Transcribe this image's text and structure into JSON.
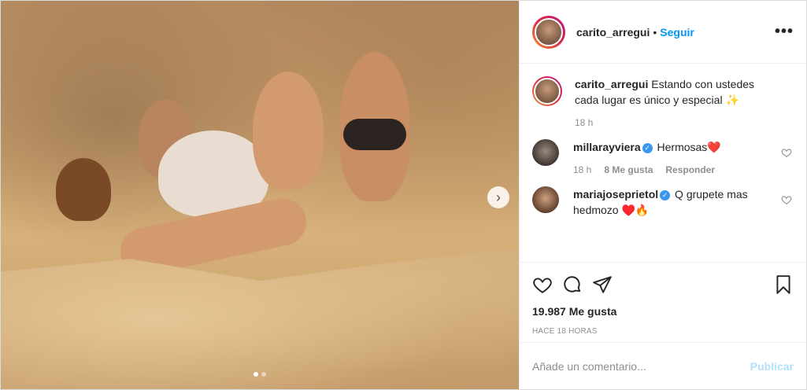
{
  "header": {
    "username": "carito_arregui",
    "separator": "•",
    "follow_label": "Seguir",
    "more_label": "•••"
  },
  "media": {
    "next_glyph": "›",
    "current_slide": 1,
    "total_slides": 2
  },
  "caption": {
    "username": "carito_arregui",
    "text": "Estando con ustedes cada lugar es único y especial ✨",
    "time": "18 h"
  },
  "comments": [
    {
      "username": "millarayviera",
      "verified": true,
      "text": "Hermosas❤️",
      "time": "18 h",
      "likes": "8 Me gusta",
      "reply_label": "Responder"
    },
    {
      "username": "mariajoseprietol",
      "verified": true,
      "text": "Q grupete mas hedmozo ♥️🔥"
    }
  ],
  "actions": {
    "icons": [
      "heart-icon",
      "comment-icon",
      "share-icon",
      "bookmark-icon"
    ],
    "likes": "19.987 Me gusta",
    "timestamp": "HACE 18 HORAS"
  },
  "add_comment": {
    "placeholder": "Añade un comentario...",
    "publish_label": "Publicar"
  },
  "colors": {
    "accent": "#0095f6",
    "publish_disabled": "#b2dffc",
    "verified": "#3897f0",
    "heart": "#ed4956"
  }
}
